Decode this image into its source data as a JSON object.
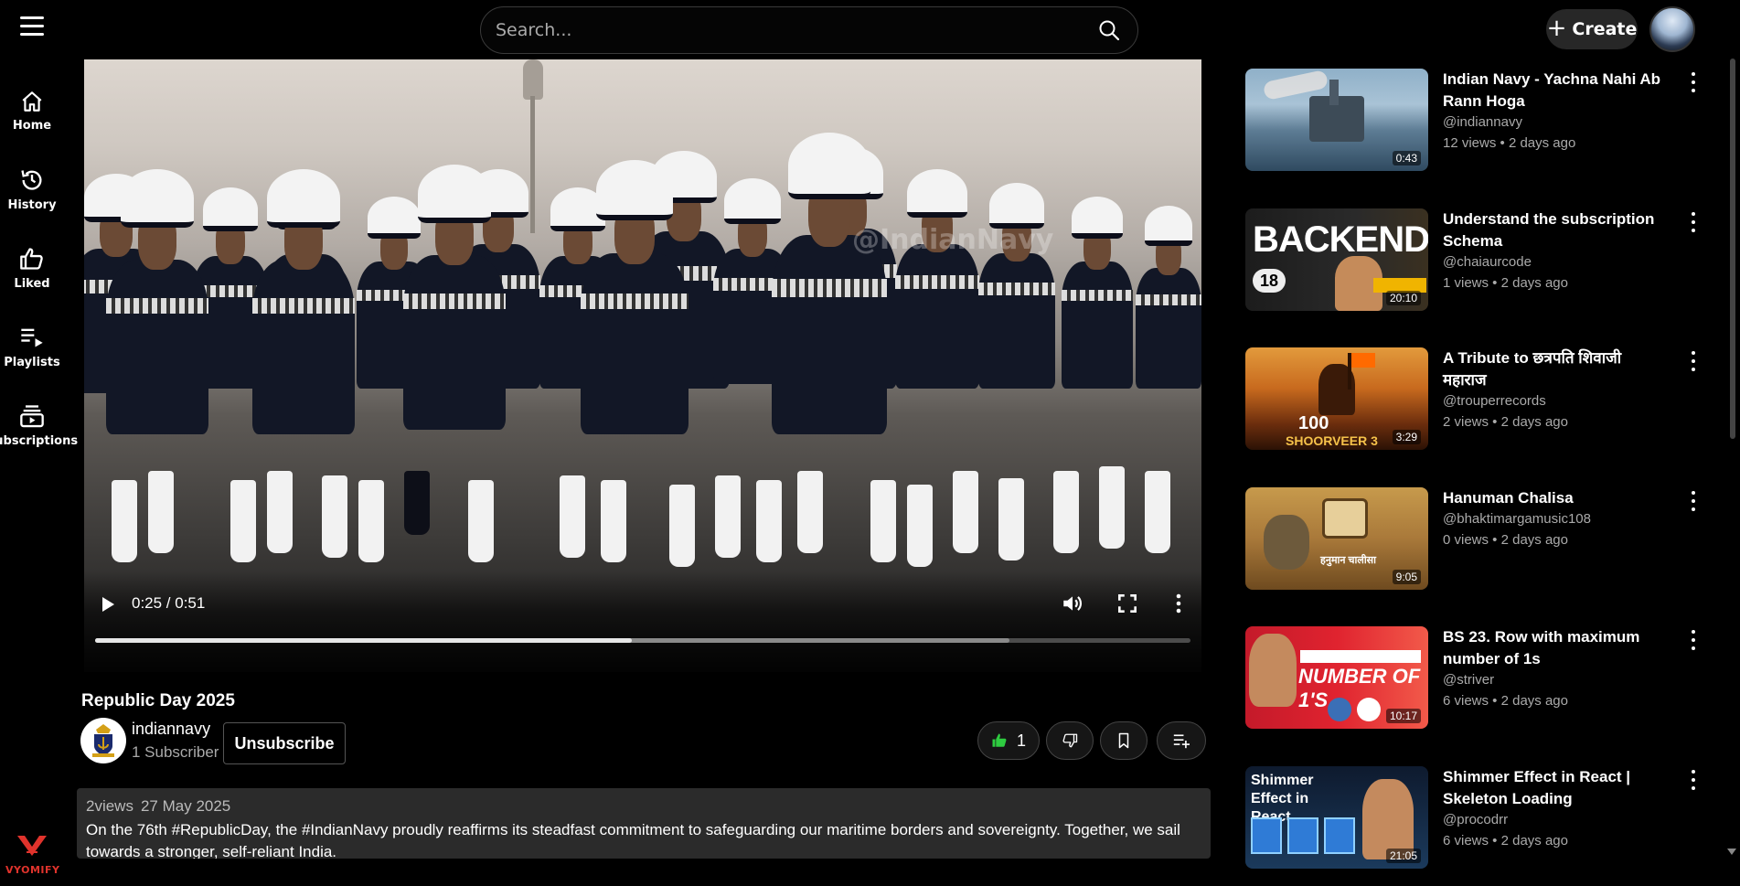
{
  "header": {
    "search_placeholder": "Search...",
    "create_label": "Create"
  },
  "sidebar": {
    "items": [
      {
        "label": "Home",
        "icon": "home-icon"
      },
      {
        "label": "History",
        "icon": "history-icon"
      },
      {
        "label": "Liked",
        "icon": "thumbs-up-icon"
      },
      {
        "label": "Playlists",
        "icon": "playlist-icon"
      },
      {
        "label": "Subscriptions",
        "icon": "subscriptions-icon"
      }
    ],
    "brand": "VYOMIFY"
  },
  "player": {
    "time": "0:25 / 0:51",
    "played_fraction": 0.49,
    "buffered_fraction": 0.835,
    "watermark": "@IndianNavy"
  },
  "video": {
    "title": "Republic Day 2025",
    "channel": "indiannavy",
    "subscribers": "1 Subscriber",
    "unsubscribe_label": "Unsubscribe",
    "likes": "1",
    "views": "2views",
    "date": "27 May 2025",
    "description": "On the 76th #RepublicDay, the #IndianNavy proudly reaffirms its steadfast commitment to safeguarding our maritime borders and sovereignty. Together, we sail towards a stronger, self-reliant India."
  },
  "recommendations": [
    {
      "title": "Indian Navy - Yachna Nahi Ab Rann Hoga",
      "channel": "@indiannavy",
      "meta": "12 views • 2 days ago",
      "duration": "0:43"
    },
    {
      "title": "Understand the subscription Schema",
      "channel": "@chaiaurcode",
      "meta": "1 views • 2 days ago",
      "duration": "20:10",
      "thumb_text": "BACKEND",
      "thumb_number": "18"
    },
    {
      "title": "A Tribute to छत्रपति शिवाजी महाराज",
      "channel": "@trouperrecords",
      "meta": "2 views • 2 days ago",
      "duration": "3:29",
      "thumb_text": "SHOORVEER 3"
    },
    {
      "title": "Hanuman Chalisa",
      "channel": "@bhaktimargamusic108",
      "meta": "0 views • 2 days ago",
      "duration": "9:05",
      "thumb_text": "हनुमान चालीसा"
    },
    {
      "title": "BS 23. Row with maximum number of 1s",
      "channel": "@striver",
      "meta": "6 views • 2 days ago",
      "duration": "10:17",
      "thumb_text": "NUMBER OF 1'S"
    },
    {
      "title": "Shimmer Effect in React | Skeleton Loading",
      "channel": "@procodrr",
      "meta": "6 views • 2 days ago",
      "duration": "21:05",
      "thumb_text": "Shimmer Effect in React"
    }
  ],
  "colors": {
    "background": "#000000",
    "panel": "#2b2b2b",
    "accent_like": "#2ecc40",
    "brand": "#e0332c"
  }
}
